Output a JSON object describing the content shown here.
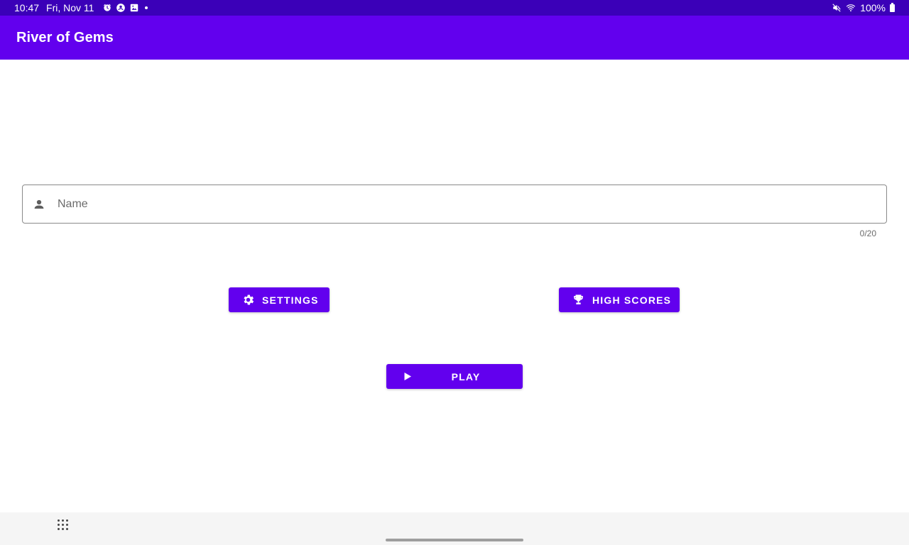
{
  "status_bar": {
    "time": "10:47",
    "date": "Fri, Nov 11",
    "battery": "100%",
    "icons": [
      "alarm-icon",
      "account-circle-icon",
      "image-notification-icon",
      "dot-icon",
      "mute-icon",
      "wifi-icon",
      "battery-icon"
    ]
  },
  "app_bar": {
    "title": "River of Gems",
    "color": "#6200ee"
  },
  "name_field": {
    "placeholder": "Name",
    "value": "",
    "counter": "0/20",
    "icon": "person-icon"
  },
  "buttons": {
    "settings": {
      "label": "SETTINGS",
      "icon": "gear-icon"
    },
    "high_scores": {
      "label": "HIGH SCORES",
      "icon": "trophy-icon"
    },
    "play": {
      "label": "PLAY",
      "icon": "play-icon"
    }
  },
  "nav_bar": {
    "icons": [
      "apps-grid-icon",
      "home-handle"
    ]
  },
  "colors": {
    "status_bar": "#3b00b8",
    "primary": "#6200ee",
    "on_primary": "#ffffff"
  }
}
